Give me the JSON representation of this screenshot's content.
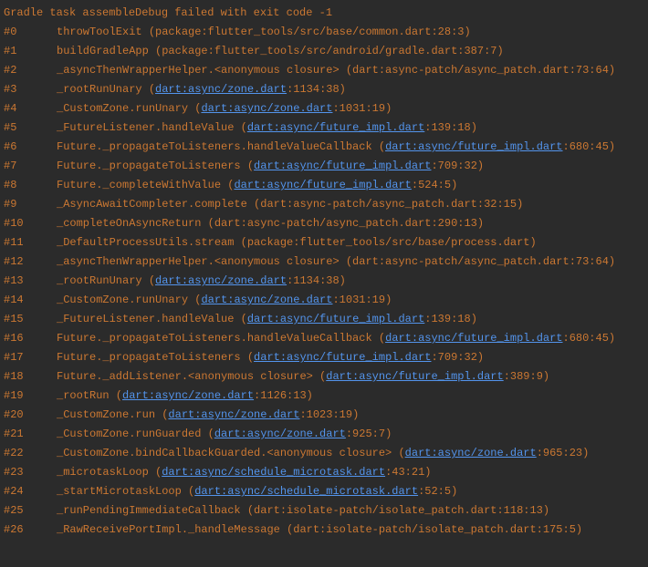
{
  "error_header": "Gradle task assembleDebug failed with exit code -1",
  "frames": [
    {
      "num": "#0",
      "text_before": "throwToolExit (package:flutter_tools/src/base/common.dart:28:3)",
      "link": "",
      "text_after": ""
    },
    {
      "num": "#1",
      "text_before": "buildGradleApp (package:flutter_tools/src/android/gradle.dart:387:7)",
      "link": "",
      "text_after": ""
    },
    {
      "num": "#2",
      "text_before": "_asyncThenWrapperHelper.<anonymous closure> (dart:async-patch/async_patch.dart:73:64)",
      "link": "",
      "text_after": ""
    },
    {
      "num": "#3",
      "text_before": "_rootRunUnary (",
      "link": "dart:async/zone.dart",
      "text_after": ":1134:38)"
    },
    {
      "num": "#4",
      "text_before": "_CustomZone.runUnary (",
      "link": "dart:async/zone.dart",
      "text_after": ":1031:19)"
    },
    {
      "num": "#5",
      "text_before": "_FutureListener.handleValue (",
      "link": "dart:async/future_impl.dart",
      "text_after": ":139:18)"
    },
    {
      "num": "#6",
      "text_before": "Future._propagateToListeners.handleValueCallback (",
      "link": "dart:async/future_impl.dart",
      "text_after": ":680:45)"
    },
    {
      "num": "#7",
      "text_before": "Future._propagateToListeners (",
      "link": "dart:async/future_impl.dart",
      "text_after": ":709:32)"
    },
    {
      "num": "#8",
      "text_before": "Future._completeWithValue (",
      "link": "dart:async/future_impl.dart",
      "text_after": ":524:5)"
    },
    {
      "num": "#9",
      "text_before": "_AsyncAwaitCompleter.complete (dart:async-patch/async_patch.dart:32:15)",
      "link": "",
      "text_after": ""
    },
    {
      "num": "#10",
      "text_before": "_completeOnAsyncReturn (dart:async-patch/async_patch.dart:290:13)",
      "link": "",
      "text_after": ""
    },
    {
      "num": "#11",
      "text_before": "_DefaultProcessUtils.stream (package:flutter_tools/src/base/process.dart)",
      "link": "",
      "text_after": ""
    },
    {
      "num": "#12",
      "text_before": "_asyncThenWrapperHelper.<anonymous closure> (dart:async-patch/async_patch.dart:73:64)",
      "link": "",
      "text_after": ""
    },
    {
      "num": "#13",
      "text_before": "_rootRunUnary (",
      "link": "dart:async/zone.dart",
      "text_after": ":1134:38)"
    },
    {
      "num": "#14",
      "text_before": "_CustomZone.runUnary (",
      "link": "dart:async/zone.dart",
      "text_after": ":1031:19)"
    },
    {
      "num": "#15",
      "text_before": "_FutureListener.handleValue (",
      "link": "dart:async/future_impl.dart",
      "text_after": ":139:18)"
    },
    {
      "num": "#16",
      "text_before": "Future._propagateToListeners.handleValueCallback (",
      "link": "dart:async/future_impl.dart",
      "text_after": ":680:45)"
    },
    {
      "num": "#17",
      "text_before": "Future._propagateToListeners (",
      "link": "dart:async/future_impl.dart",
      "text_after": ":709:32)"
    },
    {
      "num": "#18",
      "text_before": "Future._addListener.<anonymous closure> (",
      "link": "dart:async/future_impl.dart",
      "text_after": ":389:9)"
    },
    {
      "num": "#19",
      "text_before": "_rootRun (",
      "link": "dart:async/zone.dart",
      "text_after": ":1126:13)"
    },
    {
      "num": "#20",
      "text_before": "_CustomZone.run (",
      "link": "dart:async/zone.dart",
      "text_after": ":1023:19)"
    },
    {
      "num": "#21",
      "text_before": "_CustomZone.runGuarded (",
      "link": "dart:async/zone.dart",
      "text_after": ":925:7)"
    },
    {
      "num": "#22",
      "text_before": "_CustomZone.bindCallbackGuarded.<anonymous closure> (",
      "link": "dart:async/zone.dart",
      "text_after": ":965:23)"
    },
    {
      "num": "#23",
      "text_before": "_microtaskLoop (",
      "link": "dart:async/schedule_microtask.dart",
      "text_after": ":43:21)"
    },
    {
      "num": "#24",
      "text_before": "_startMicrotaskLoop (",
      "link": "dart:async/schedule_microtask.dart",
      "text_after": ":52:5)"
    },
    {
      "num": "#25",
      "text_before": "_runPendingImmediateCallback (dart:isolate-patch/isolate_patch.dart:118:13)",
      "link": "",
      "text_after": ""
    },
    {
      "num": "#26",
      "text_before": "_RawReceivePortImpl._handleMessage (dart:isolate-patch/isolate_patch.dart:175:5)",
      "link": "",
      "text_after": ""
    }
  ]
}
